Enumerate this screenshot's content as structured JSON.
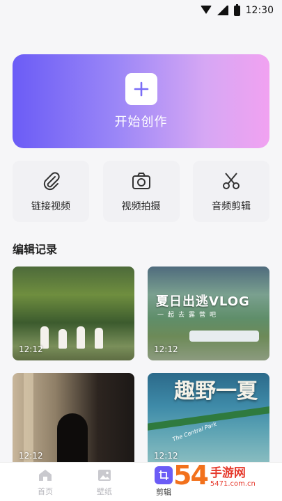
{
  "status_bar": {
    "time": "12:30",
    "icons": [
      "wifi-icon",
      "signal-icon",
      "battery-icon"
    ]
  },
  "create": {
    "label": "开始创作",
    "icon": "plus-icon"
  },
  "tools": [
    {
      "label": "链接视频",
      "icon": "paperclip-icon"
    },
    {
      "label": "视频拍摄",
      "icon": "camera-icon"
    },
    {
      "label": "音频剪辑",
      "icon": "scissors-icon"
    }
  ],
  "records": {
    "title": "编辑记录",
    "items": [
      {
        "time": "12:12"
      },
      {
        "time": "12:12",
        "overlay_title": "夏日出逃VLOG",
        "overlay_sub": "一起去露营吧"
      },
      {
        "time": "12:12"
      },
      {
        "time": "12:12",
        "overlay_title": "趣野一夏",
        "overlay_sub": "The Central Park"
      }
    ]
  },
  "bottom_nav": {
    "items": [
      {
        "label": "首页",
        "icon": "home-icon"
      },
      {
        "label": "壁纸",
        "icon": "image-icon"
      },
      {
        "label": "剪辑",
        "icon": "crop-icon",
        "active": true
      }
    ]
  },
  "watermark": {
    "logo": "54",
    "main": "手游网",
    "url": "5471.com.cn"
  },
  "colors": {
    "accent": "#6b5cf6",
    "background": "#f6f6f8"
  }
}
